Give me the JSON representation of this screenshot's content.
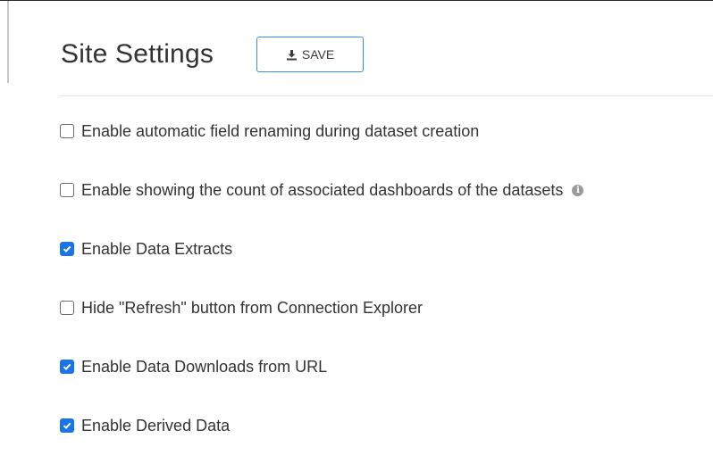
{
  "header": {
    "title": "Site Settings",
    "save_label": "SAVE",
    "save_icon": "download-icon"
  },
  "settings": [
    {
      "label": "Enable automatic field renaming during dataset creation",
      "checked": false,
      "has_info": false
    },
    {
      "label": "Enable showing the count of associated dashboards of the datasets",
      "checked": false,
      "has_info": true
    },
    {
      "label": "Enable Data Extracts",
      "checked": true,
      "has_info": false
    },
    {
      "label": "Hide \"Refresh\" button from Connection Explorer",
      "checked": false,
      "has_info": false
    },
    {
      "label": "Enable Data Downloads from URL",
      "checked": true,
      "has_info": false
    },
    {
      "label": "Enable Derived Data",
      "checked": true,
      "has_info": false
    }
  ],
  "colors": {
    "accent": "#1a73e8",
    "button_border": "#3a8fd9",
    "info_icon": "#9a9a9a"
  },
  "icons": {
    "info": "info-icon",
    "checked": "checkmark-icon"
  }
}
